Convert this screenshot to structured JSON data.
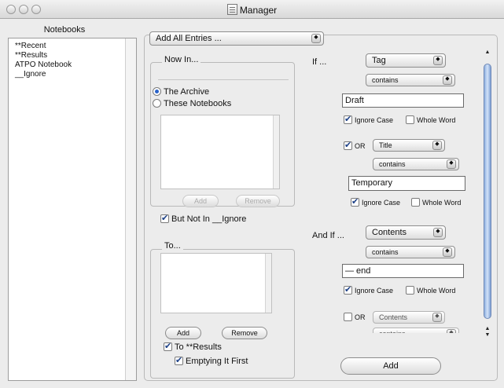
{
  "window": {
    "title": "Manager",
    "traffic_lights": [
      "close",
      "minimize",
      "zoom"
    ]
  },
  "notebooks": {
    "header": "Notebooks",
    "items": [
      "**Recent",
      "**Results",
      "ATPO Notebook",
      "__Ignore"
    ]
  },
  "main": {
    "action_popup": "Add All Entries ...",
    "now_in": {
      "title": "Now In...",
      "radio_archive": "The Archive",
      "radio_notebooks": "These Notebooks",
      "add": "Add",
      "remove": "Remove",
      "but_not_in": "But Not In  __Ignore"
    },
    "to": {
      "title": "To...",
      "add": "Add",
      "remove": "Remove",
      "to_results": "To **Results",
      "emptying": "Emptying It First"
    },
    "conditions": {
      "if_label": "If ...",
      "c1": {
        "field": "Tag",
        "op": "contains",
        "value": "Draft",
        "ignore_case": "Ignore Case",
        "whole_word": "Whole Word"
      },
      "c2": {
        "or_label": "OR",
        "field": "Title",
        "op": "contains",
        "value": "Temporary",
        "ignore_case": "Ignore Case",
        "whole_word": "Whole Word"
      },
      "and_if_label": "And If ...",
      "c3": {
        "field": "Contents",
        "op": "contains",
        "value": "— end",
        "ignore_case": "Ignore Case",
        "whole_word": "Whole Word"
      },
      "c4": {
        "or_label": "OR",
        "field": "Contents",
        "op": "contains"
      }
    },
    "add_button": "Add"
  },
  "icons": {
    "popup_arrows": "◆",
    "scroll_up": "▲",
    "scroll_down": "▼"
  }
}
